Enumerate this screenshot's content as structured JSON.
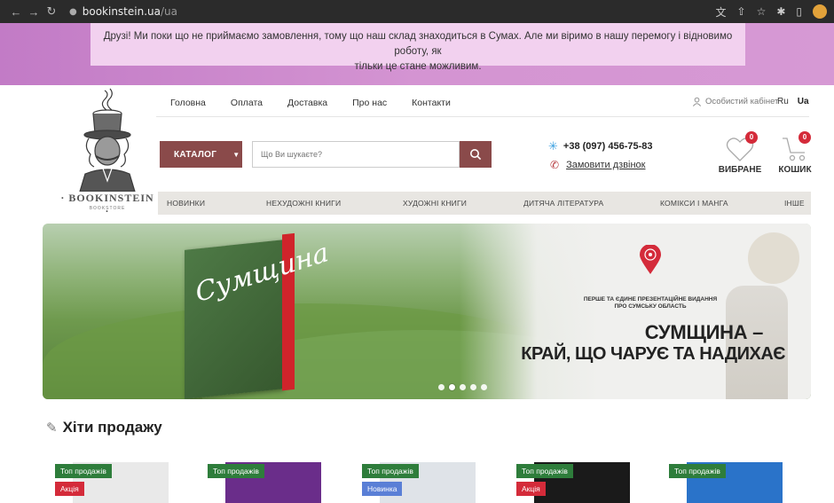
{
  "browser": {
    "url_host": "bookinstein.ua",
    "url_path": "/ua",
    "nav_icons": [
      "back-icon",
      "forward-icon",
      "reload-icon"
    ],
    "toolbar_icons": [
      "translate-icon",
      "share-icon",
      "bookmark-star-icon",
      "extensions-icon",
      "sidebar-icon",
      "profile-avatar-icon"
    ]
  },
  "announcement": {
    "line1": "Друзі! Ми поки що не приймаємо замовлення, тому що наш склад знаходиться в Сумах. Але ми віримо в нашу перемогу і відновимо роботу, як",
    "line2": "тільки це стане можливим."
  },
  "logo": {
    "brand": "· BOOKINSTEIN ·",
    "sub": "BOOKSTORE"
  },
  "topnav": [
    "Головна",
    "Оплата",
    "Доставка",
    "Про нас",
    "Контакти"
  ],
  "account": {
    "label": "Особистий кабінет"
  },
  "lang": {
    "ru": "Ru",
    "ua": "Ua"
  },
  "catalog_label": "КАТАЛОГ",
  "search": {
    "placeholder": "Що Ви шукаєте?"
  },
  "contact": {
    "phone": "+38 (097) 456-75-83",
    "callback": "Замовити дзвінок"
  },
  "favorites": {
    "label": "ВИБРАНЕ",
    "count": "0"
  },
  "cart": {
    "label": "КОШИК",
    "count": "0"
  },
  "categories": [
    "НОВИНКИ",
    "НЕХУДОЖНІ КНИГИ",
    "ХУДОЖНІ КНИГИ",
    "ДИТЯЧА ЛІТЕРАТУРА",
    "КОМІКСИ І МАНГА",
    "ІНШЕ"
  ],
  "hero": {
    "book_title": "Сумщина",
    "tagline_1": "ПЕРШЕ ТА ЄДИНЕ ПРЕЗЕНТАЦІЙНЕ ВИДАННЯ",
    "tagline_2": "ПРО СУМСЬКУ ОБЛАСТЬ",
    "headline_1": "СУМЩИНА –",
    "headline_2": "КРАЙ, ЩО ЧАРУЄ ТА НАДИХАЄ",
    "slides_count": 5,
    "active_slide": 1
  },
  "bestsellers": {
    "title": "Хіти продажу",
    "products": [
      {
        "tag_top": "Топ продажів",
        "tag_second": "Акція",
        "second_type": "sale"
      },
      {
        "tag_top": "Топ продажів",
        "tag_second": "",
        "second_type": ""
      },
      {
        "tag_top": "Топ продажів",
        "tag_second": "Новинка",
        "second_type": "new"
      },
      {
        "tag_top": "Топ продажів",
        "tag_second": "Акція",
        "second_type": "sale"
      },
      {
        "tag_top": "Топ продажів",
        "tag_second": "",
        "second_type": ""
      }
    ]
  },
  "colors": {
    "brand": "#8a4a4a",
    "badge": "#d42b3a",
    "tag_top": "#2e7d3b",
    "tag_new": "#5a7fd6",
    "announcement_bg": "#f2d1ef"
  }
}
